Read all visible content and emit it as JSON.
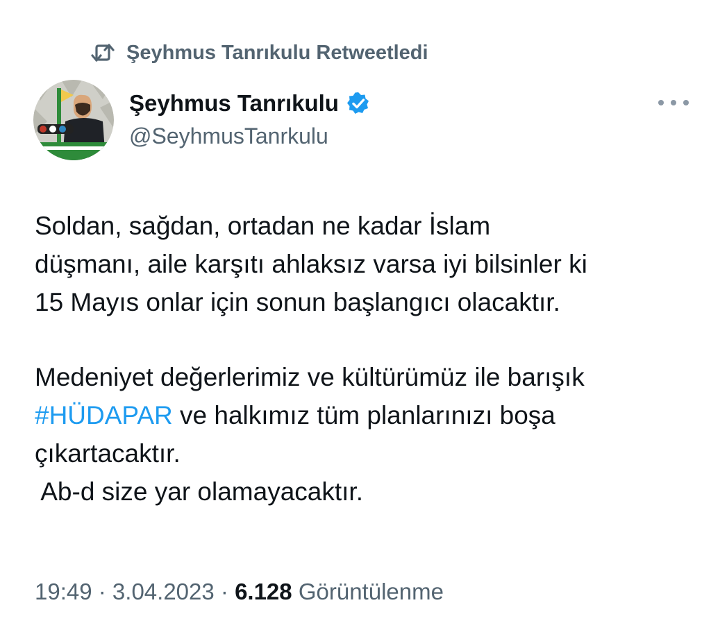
{
  "retweet": {
    "icon": "retweet-icon",
    "label": "Şeyhmus Tanrıkulu Retweetledi"
  },
  "author": {
    "name": "Şeyhmus Tanrıkulu",
    "handle": "@SeyhmusTanrkulu",
    "verified_icon": "verified-badge-icon",
    "avatar": "avatar"
  },
  "menu": {
    "icon": "more-options-icon"
  },
  "tweet": {
    "lines_para1": [
      "Soldan, sağdan, ortadan ne kadar İslam",
      "düşmanı, aile karşıtı ahlaksız varsa iyi bilsinler ki",
      "15 Mayıs onlar için sonun başlangıcı olacaktır."
    ],
    "line_para2_1": "Medeniyet değerlerimiz ve kültürümüz ile barışık",
    "hashtag": "#HÜDAPAR",
    "line_para2_2_rest": " ve halkımız tüm planlarınızı boşa",
    "line_para2_3": "çıkartacaktır.",
    "line_para3": " Ab-d size yar olamayacaktır."
  },
  "meta": {
    "time": "19:49",
    "separator": " · ",
    "date": "3.04.2023",
    "views_count": "6.128",
    "views_label": " Görüntülenme"
  },
  "colors": {
    "text": "#0f1419",
    "muted": "#536471",
    "link": "#1d9bf0",
    "verified": "#1d9bf0"
  }
}
